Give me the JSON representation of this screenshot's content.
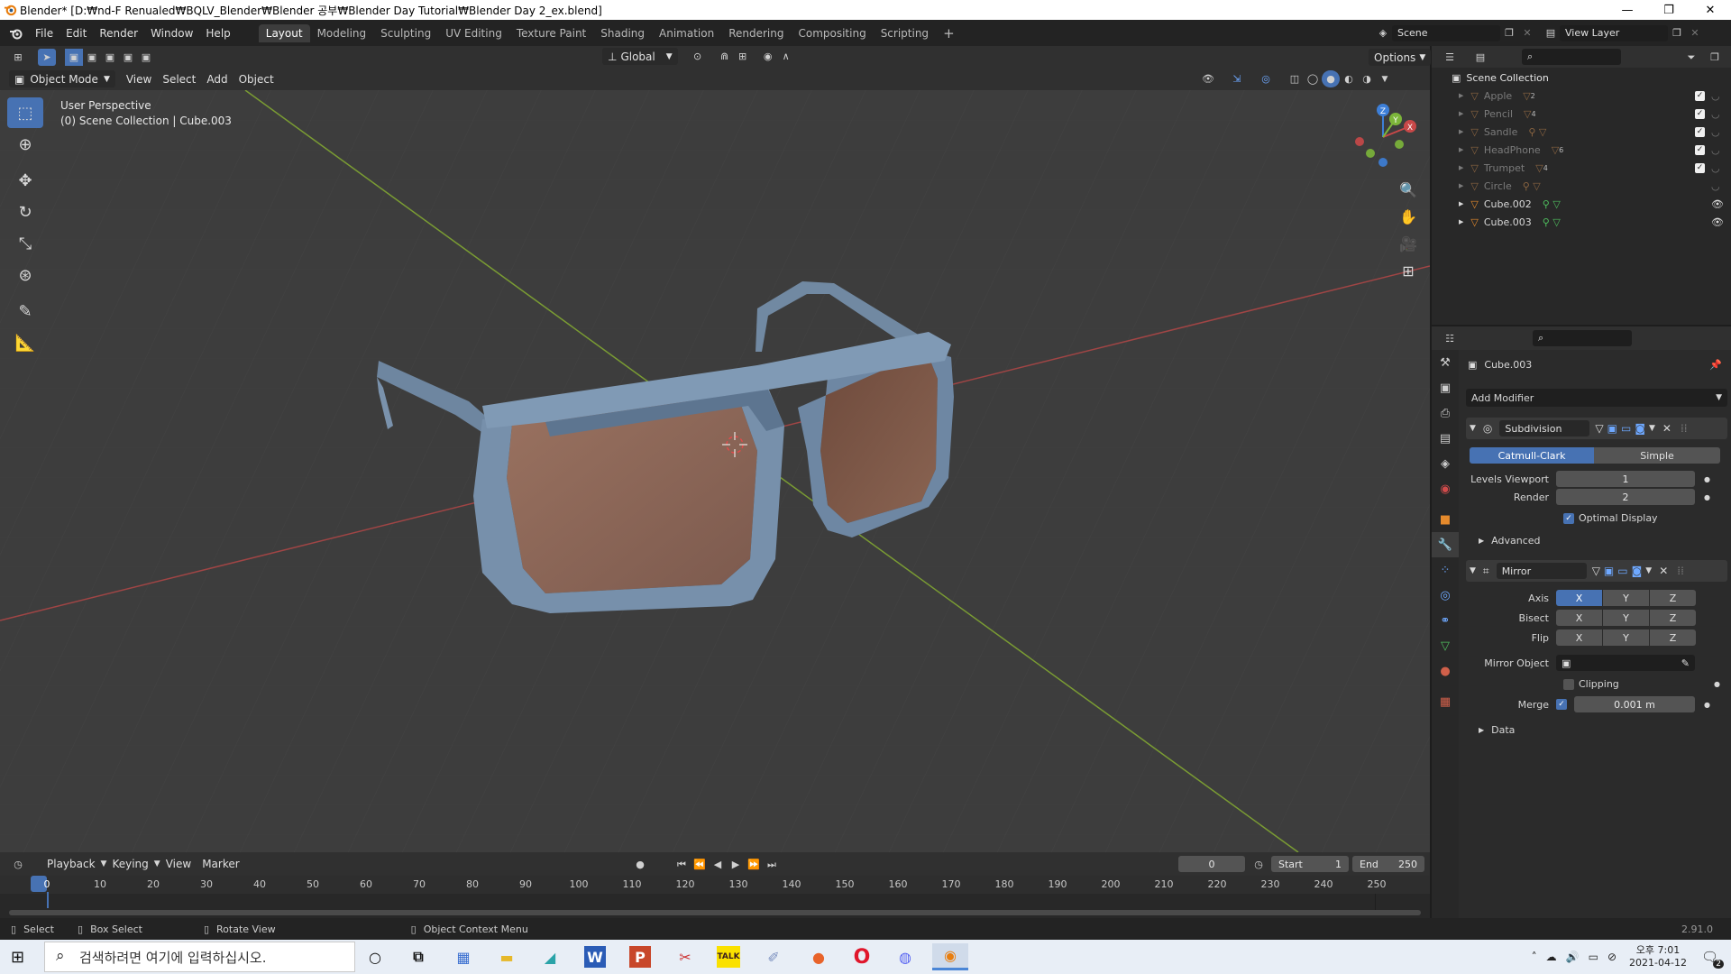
{
  "window": {
    "title": "Blender* [D:₩nd-F Renualed₩BQLV_Blender₩Blender 공부₩Blender Day Tutorial₩Blender Day 2_ex.blend]",
    "controls": [
      "—",
      "❐",
      "✕"
    ]
  },
  "menubar": {
    "items": [
      "File",
      "Edit",
      "Render",
      "Window",
      "Help"
    ],
    "workspaces": [
      "Layout",
      "Modeling",
      "Sculpting",
      "UV Editing",
      "Texture Paint",
      "Shading",
      "Animation",
      "Rendering",
      "Compositing",
      "Scripting"
    ],
    "active_workspace": "Layout",
    "add_tab": "+",
    "scene_label": "Scene",
    "view_layer_label": "View Layer"
  },
  "viewport_header": {
    "transform_orientation": "Global",
    "options_label": "Options",
    "mode": "Object Mode",
    "menus": [
      "View",
      "Select",
      "Add",
      "Object"
    ]
  },
  "viewport": {
    "perspective_label": "User Perspective",
    "collection_label": "(0) Scene Collection | Cube.003",
    "gizmo_axes": {
      "x": "X",
      "y": "Y",
      "z": "Z"
    },
    "colors": {
      "background": "#3d3d3d",
      "x_axis": "#c44f4f",
      "y_axis": "#8cb83a",
      "frame": "#7990a8",
      "lens": "#8c665a"
    }
  },
  "toolbar": {
    "tools": [
      "select-box-icon",
      "cursor-icon",
      "move-icon",
      "rotate-icon",
      "scale-icon",
      "transform-icon",
      "annotate-icon",
      "measure-icon"
    ]
  },
  "timeline": {
    "menus": [
      "Playback",
      "Keying",
      "View",
      "Marker"
    ],
    "current_frame": "0",
    "start_label": "Start",
    "start_value": "1",
    "end_label": "End",
    "end_value": "250",
    "ruler": [
      "0",
      "10",
      "20",
      "30",
      "40",
      "50",
      "60",
      "70",
      "80",
      "90",
      "100",
      "110",
      "120",
      "130",
      "140",
      "150",
      "160",
      "170",
      "180",
      "190",
      "200",
      "210",
      "220",
      "230",
      "240",
      "250"
    ]
  },
  "statusbar": {
    "items": [
      "Select",
      "Box Select",
      "Rotate View",
      "Object Context Menu"
    ],
    "version": "2.91.0"
  },
  "outliner": {
    "root": "Scene Collection",
    "items": [
      {
        "name": "Apple",
        "badge": "2",
        "dim": true,
        "checked": true
      },
      {
        "name": "Pencil",
        "badge": "4",
        "dim": true,
        "checked": true
      },
      {
        "name": "Sandle",
        "badge": "",
        "dim": true,
        "checked": true
      },
      {
        "name": "HeadPhone",
        "badge": "6",
        "dim": true,
        "checked": true
      },
      {
        "name": "Trumpet",
        "badge": "4",
        "dim": true,
        "checked": true
      },
      {
        "name": "Circle",
        "badge": "",
        "dim": true,
        "checked": false
      },
      {
        "name": "Cube.002",
        "badge": "",
        "dim": false,
        "checked": false
      },
      {
        "name": "Cube.003",
        "badge": "",
        "dim": false,
        "checked": false
      }
    ]
  },
  "properties": {
    "object_name": "Cube.003",
    "add_modifier": "Add Modifier",
    "subdivision": {
      "name": "Subdivision",
      "modes": [
        "Catmull-Clark",
        "Simple"
      ],
      "active_mode": "Catmull-Clark",
      "levels_viewport_label": "Levels Viewport",
      "levels_viewport": "1",
      "render_label": "Render",
      "render": "2",
      "optimal_display": "Optimal Display",
      "advanced": "Advanced"
    },
    "mirror": {
      "name": "Mirror",
      "axis_label": "Axis",
      "bisect_label": "Bisect",
      "flip_label": "Flip",
      "xyz": [
        "X",
        "Y",
        "Z"
      ],
      "mirror_object_label": "Mirror Object",
      "clipping": "Clipping",
      "merge_label": "Merge",
      "merge_value": "0.001 m",
      "data": "Data"
    }
  },
  "taskbar": {
    "search_placeholder": "검색하려면 여기에 입력하십시오.",
    "time": "오후 7:01",
    "date": "2021-04-12",
    "notification_count": "2"
  }
}
